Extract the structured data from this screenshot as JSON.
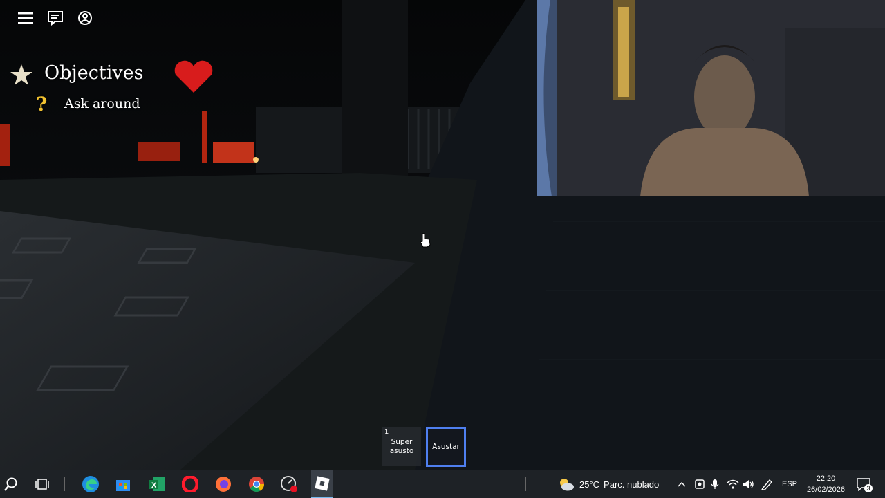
{
  "hud": {
    "menu_icon": "hamburger-menu-icon",
    "chat_icon": "chat-icon",
    "emote_icon": "emote-icon"
  },
  "objectives": {
    "title": "Objectives",
    "items": [
      {
        "icon": "question-mark-icon",
        "text": "Ask around"
      }
    ],
    "heart_icon": "heart-icon"
  },
  "hotbar": {
    "slots": [
      {
        "number": "1",
        "label_line1": "Super",
        "label_line2": "asusto",
        "selected": false
      },
      {
        "number": "",
        "label": "Asustar",
        "selected": true
      }
    ]
  },
  "taskbar": {
    "apps": [
      "search-icon",
      "task-view-icon",
      "edge-icon",
      "store-icon",
      "excel-icon",
      "opera-icon",
      "firefox-icon",
      "chrome-icon",
      "recorder-icon",
      "roblox-icon"
    ],
    "weather": {
      "temp": "25°C",
      "desc": "Parc. nublado"
    },
    "language": "ESP",
    "time": "22:20",
    "date": "26/02/2026",
    "notifications": "3"
  },
  "colors": {
    "accent": "#4f7ff0",
    "heart": "#d81c1c",
    "taskbar": "#1e2226"
  }
}
